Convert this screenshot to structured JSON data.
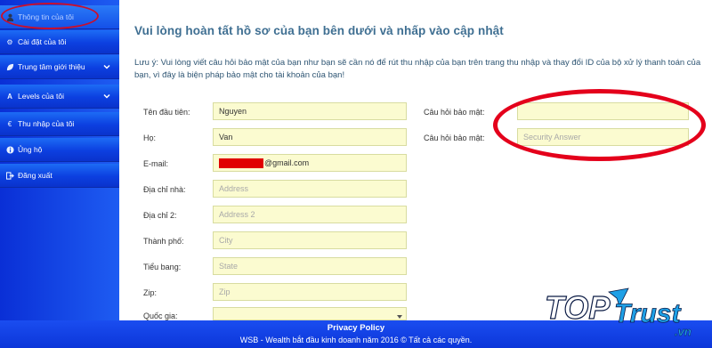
{
  "sidebar": {
    "items": [
      {
        "label": "Thông tin của tôi",
        "icon": "user-icon"
      },
      {
        "label": "Cài đặt của tôi",
        "icon": "gear-icon"
      },
      {
        "label": "Trung tâm giới thiệu",
        "icon": "leaf-icon"
      },
      {
        "label": "Levels của tôi",
        "icon": "font-icon"
      },
      {
        "label": "Thu nhập của tôi",
        "icon": "euro-icon"
      },
      {
        "label": "Ủng hộ",
        "icon": "info-icon"
      },
      {
        "label": "Đăng xuất",
        "icon": "logout-icon"
      }
    ]
  },
  "main": {
    "title": "Vui lòng hoàn tất hồ sơ của bạn bên dưới và nhấp vào cập nhật",
    "note": "Lưu ý: Vui lòng viết câu hỏi bảo mật của bạn như bạn sẽ cần nó để rút thu nhập của bạn trên trang thu nhập và thay đổi ID của bộ xử lý thanh toán của bạn, vì đây là biện pháp bảo mật cho tài khoản của bạn!",
    "fields": {
      "first_name": {
        "label": "Tên đầu tiên:",
        "value": "Nguyen"
      },
      "last_name": {
        "label": "Họ:",
        "value": "Van"
      },
      "email": {
        "label": "E-mail:",
        "value": "@gmail.com"
      },
      "address": {
        "label": "Địa chỉ nhà:",
        "placeholder": "Address"
      },
      "address2": {
        "label": "Địa chỉ 2:",
        "placeholder": "Address 2"
      },
      "city": {
        "label": "Thành phố:",
        "placeholder": "City"
      },
      "state": {
        "label": "Tiểu bang:",
        "placeholder": "State"
      },
      "zip": {
        "label": "Zip:",
        "placeholder": "Zip"
      },
      "country": {
        "label": "Quốc gia:",
        "value": ""
      },
      "security_question": {
        "label": "Câu hỏi bảo mật:",
        "value": ""
      },
      "security_answer": {
        "label": "Câu hỏi bảo mật:",
        "placeholder": "Security Answer"
      }
    }
  },
  "footer": {
    "privacy": "Privacy Policy",
    "copyright": "WSB - Wealth bắt đầu kinh doanh năm 2016 © Tất cả các quyền."
  },
  "watermark": {
    "text": "TOPTrust.vn"
  },
  "colors": {
    "sidebar": "#0c3fe0",
    "title": "#3f6f92",
    "input_bg": "#fbfbd0",
    "annotation_ring": "#e4001b"
  }
}
